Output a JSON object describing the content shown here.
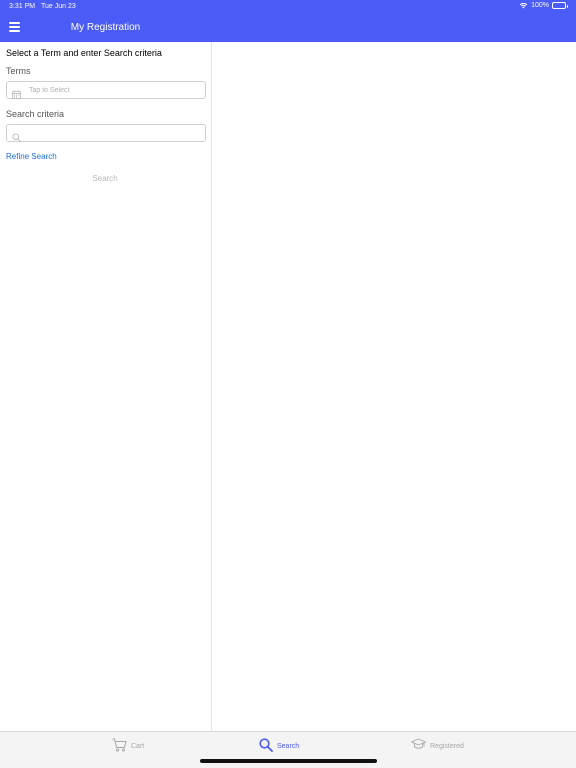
{
  "status_bar": {
    "time": "3:31 PM",
    "date": "Tue Jun 23",
    "battery": "100%"
  },
  "nav": {
    "title": "My Registration"
  },
  "form": {
    "instruction": "Select a Term and enter Search criteria",
    "terms_label": "Terms",
    "terms_placeholder": "Tap to Select",
    "criteria_label": "Search criteria",
    "criteria_placeholder": "",
    "refine_link": "Refine Search",
    "search_button": "Search"
  },
  "tabs": [
    {
      "label": "Cart",
      "icon": "cart-icon",
      "active": false
    },
    {
      "label": "Search",
      "icon": "search-icon",
      "active": true
    },
    {
      "label": "Registered",
      "icon": "graduation-cap-icon",
      "active": false
    }
  ],
  "colors": {
    "brand": "#4b5bf5",
    "link": "#1a6fd8",
    "inactive": "#a6a6a6"
  }
}
